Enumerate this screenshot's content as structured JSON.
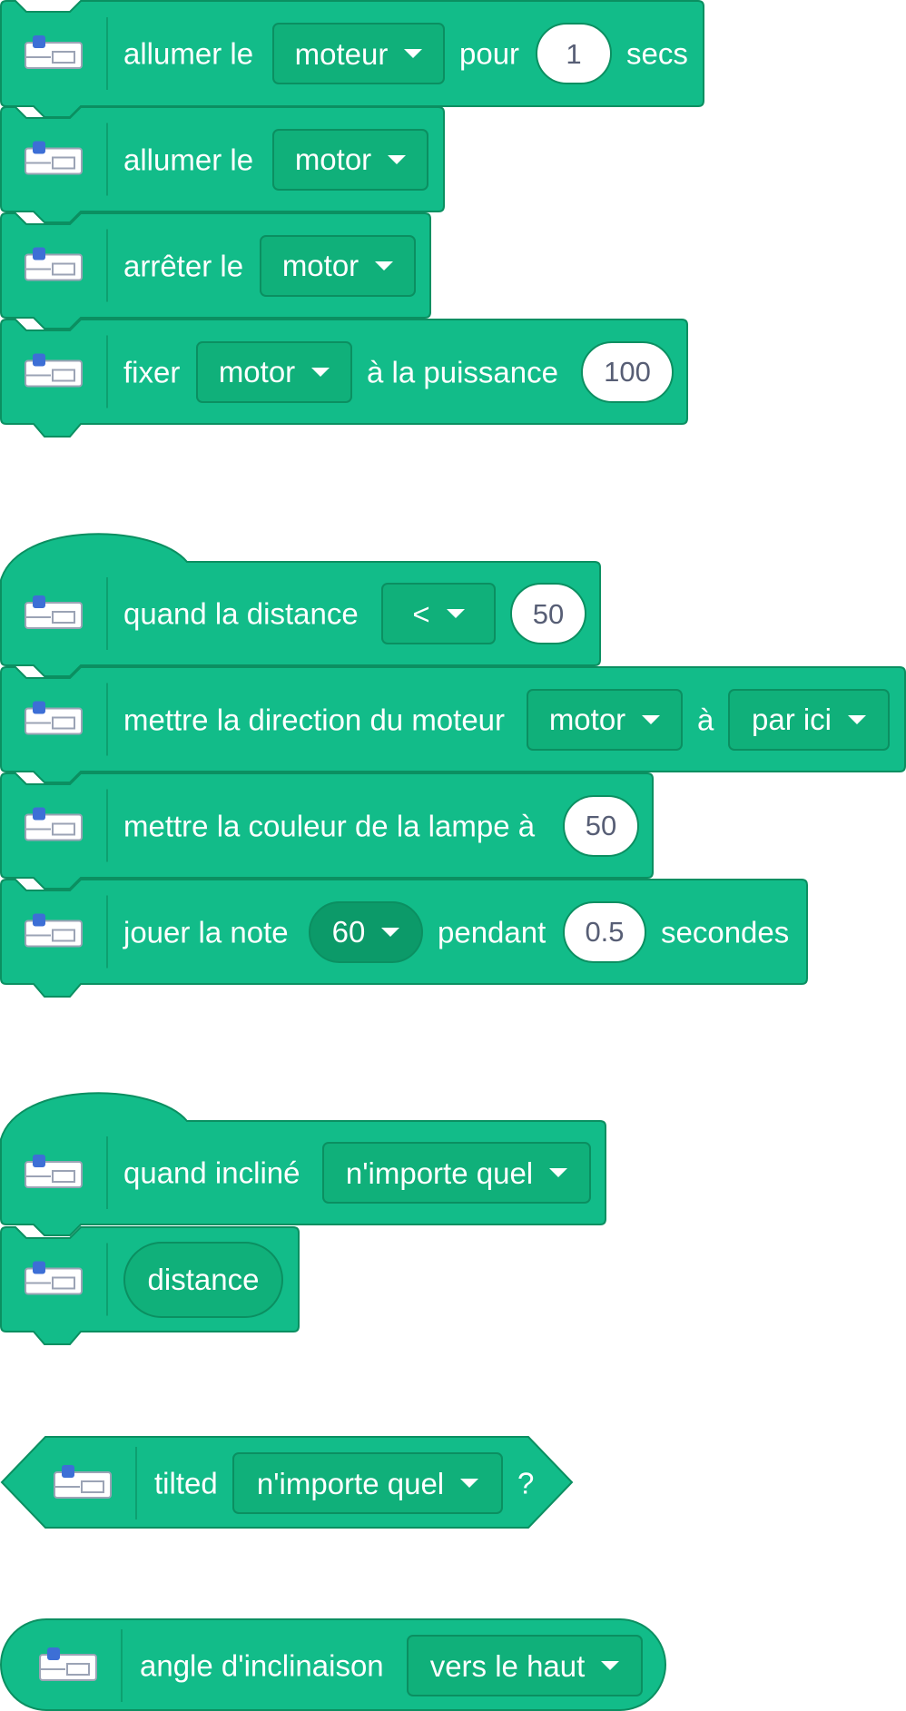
{
  "colors": {
    "block": "#12bc89",
    "block_border": "#0b8f61",
    "field_bg": "#10b07a",
    "number_text": "#575e75"
  },
  "icons": {
    "extension": "robot-brick-icon",
    "dropdown": "caret-down-icon"
  },
  "blocks": [
    {
      "kind": "command",
      "parts": [
        {
          "type": "text",
          "value": "allumer le"
        },
        {
          "type": "dropdown",
          "value": "moteur"
        },
        {
          "type": "text",
          "value": "pour"
        },
        {
          "type": "number",
          "value": "1"
        },
        {
          "type": "text",
          "value": "secs"
        }
      ]
    },
    {
      "kind": "command",
      "parts": [
        {
          "type": "text",
          "value": "allumer le"
        },
        {
          "type": "dropdown",
          "value": "motor"
        }
      ]
    },
    {
      "kind": "command",
      "parts": [
        {
          "type": "text",
          "value": "arrêter le"
        },
        {
          "type": "dropdown",
          "value": "motor"
        }
      ]
    },
    {
      "kind": "command",
      "parts": [
        {
          "type": "text",
          "value": "fixer"
        },
        {
          "type": "dropdown",
          "value": "motor"
        },
        {
          "type": "text",
          "value": "à la puissance"
        },
        {
          "type": "number",
          "value": "100"
        }
      ]
    },
    {
      "kind": "hat",
      "parts": [
        {
          "type": "text",
          "value": "quand la distance"
        },
        {
          "type": "dropdown",
          "value": "<"
        },
        {
          "type": "number",
          "value": "50"
        }
      ]
    },
    {
      "kind": "command",
      "parts": [
        {
          "type": "text",
          "value": "mettre la direction du moteur"
        },
        {
          "type": "dropdown",
          "value": "motor"
        },
        {
          "type": "text",
          "value": "à"
        },
        {
          "type": "dropdown",
          "value": "par ici"
        }
      ]
    },
    {
      "kind": "command",
      "parts": [
        {
          "type": "text",
          "value": "mettre la couleur de la lampe à"
        },
        {
          "type": "number",
          "value": "50"
        }
      ]
    },
    {
      "kind": "command",
      "parts": [
        {
          "type": "text",
          "value": "jouer la note"
        },
        {
          "type": "note",
          "value": "60"
        },
        {
          "type": "text",
          "value": "pendant"
        },
        {
          "type": "number",
          "value": "0.5"
        },
        {
          "type": "text",
          "value": "secondes"
        }
      ]
    },
    {
      "kind": "hat",
      "parts": [
        {
          "type": "text",
          "value": "quand incliné"
        },
        {
          "type": "dropdown",
          "value": "n'importe quel"
        }
      ]
    },
    {
      "kind": "command",
      "parts": [
        {
          "type": "reporter",
          "value": "distance"
        }
      ]
    },
    {
      "kind": "boolean",
      "parts": [
        {
          "type": "text",
          "value": "tilted"
        },
        {
          "type": "dropdown",
          "value": "n'importe quel"
        },
        {
          "type": "text",
          "value": "?"
        }
      ]
    },
    {
      "kind": "reporter",
      "parts": [
        {
          "type": "text",
          "value": "angle d'inclinaison"
        },
        {
          "type": "dropdown",
          "value": "vers le haut"
        }
      ]
    }
  ]
}
